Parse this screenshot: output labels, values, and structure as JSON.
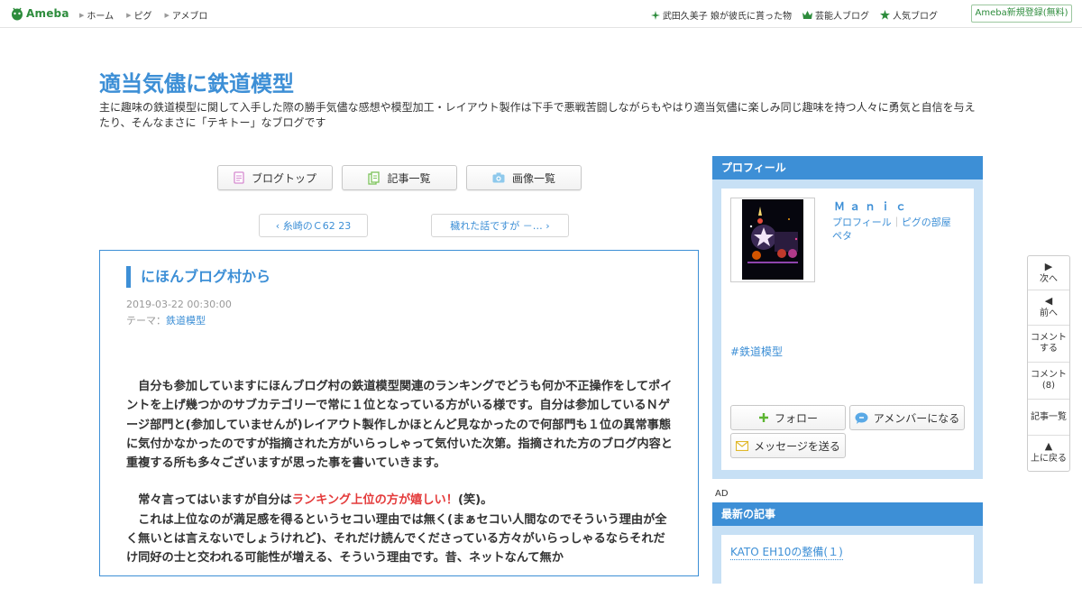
{
  "header": {
    "logo_text": "Ameba",
    "nav": [
      "ホーム",
      "ピグ",
      "アメブロ"
    ],
    "right_links": [
      {
        "label": "武田久美子 娘が彼氏に貰った物",
        "icon": "sparkle-icon"
      },
      {
        "label": "芸能人ブログ",
        "icon": "crown-icon"
      },
      {
        "label": "人気ブログ",
        "icon": "star-icon"
      }
    ],
    "register_label": "Ameba新規登録(無料)"
  },
  "blog": {
    "title": "適当気儘に鉄道模型",
    "description": "主に趣味の鉄道模型に関して入手した際の勝手気儘な感想や模型加工・レイアウト製作は下手で悪戦苦闘しながらもやはり適当気儘に楽しみ同じ趣味を持つ人々に勇気と自信を与えたり、そんなまさに「テキトー」なブログです"
  },
  "nav_buttons": {
    "top": "ブログトップ",
    "list": "記事一覧",
    "images": "画像一覧"
  },
  "pager": {
    "prev": "糸崎のＣ62 23",
    "next": "穢れた話ですが －…"
  },
  "entry": {
    "title": "にほんブログ村から",
    "date": "2019-03-22 00:30:00",
    "theme_label": "テーマ：",
    "theme": "鉄道模型",
    "para1": "　自分も参加していますにほんブログ村の鉄道模型関連のランキングでどうも何か不正操作をしてポイントを上げ幾つかのサブカテゴリーで常に１位となっている方がいる様です。自分は参加しているＮゲージ部門と(参加していませんが)レイアウト製作しかほとんど見なかったので何部門も１位の異常事態に気付かなかったのですが指摘された方がいらっしゃって気付いた次第。指摘された方のブログ内容と重複する所も多々ございますが思った事を書いていきます。",
    "para2_pre": "　常々言ってはいますが自分は",
    "para2_red": "ランキング上位の方が嬉しい！",
    "para2_post": "(笑)。",
    "para3": "　これは上位なのが満足感を得るというセコい理由では無く(まぁセコい人間なのでそういう理由が全く無いとは言えないでしょうけれど)、それだけ読んでくださっている方々がいらっしゃるならそれだけ同好の士と交われる可能性が増える、そういう理由です。昔、ネットなんて無か"
  },
  "profile": {
    "heading": "プロフィール",
    "name": "Ｍａｎｉｃ",
    "link_profile": "プロフィール",
    "link_separator": "｜",
    "link_pig": "ピグの部屋",
    "link_peta": "ペタ",
    "hashtag": "#鉄道模型",
    "follow": "フォロー",
    "member": "アメンバーになる",
    "message": "メッセージを送る"
  },
  "ad_label": "AD",
  "latest": {
    "heading": "最新の記事",
    "first": "KATO EH10の整備(１)"
  },
  "floatbar": {
    "next": "次へ",
    "prev": "前へ",
    "comment_line1": "コメント",
    "comment_line2": "する",
    "comments_line1": "コメント",
    "comments_line2": "(8)",
    "list": "記事一覧",
    "top_line1": "上に戻る"
  },
  "colors": {
    "accent": "#3d8fd6",
    "brand": "#2d8c3c",
    "highlight": "#e43b3b",
    "sidebar_bg": "#c7e0f5"
  }
}
